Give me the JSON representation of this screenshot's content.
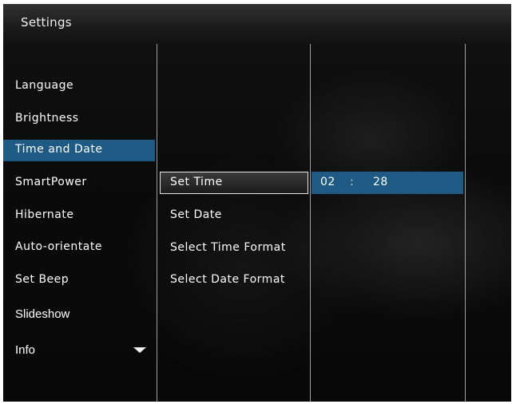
{
  "title_bar": {
    "title": "Settings"
  },
  "level1_menu": {
    "items": [
      {
        "label": "Language"
      },
      {
        "label": "Brightness"
      },
      {
        "label": "Time and Date"
      },
      {
        "label": "SmartPower"
      },
      {
        "label": "Hibernate"
      },
      {
        "label": "Auto-orientate"
      },
      {
        "label": "Set Beep"
      },
      {
        "label": "Slideshow"
      },
      {
        "label": "Info"
      }
    ],
    "selected_index": 2,
    "scroll_icon": "chevron-down-icon"
  },
  "level2_menu": {
    "items": [
      {
        "label": "Set Time"
      },
      {
        "label": "Set Date"
      },
      {
        "label": "Select Time Format"
      },
      {
        "label": "Select Date Format"
      }
    ],
    "selected_index": 0
  },
  "time_editor": {
    "hour": "02",
    "separator": ":",
    "minute": "28"
  },
  "colors": {
    "highlight_blue": "#1d5a84",
    "text": "#ffffff",
    "background": "#0b0b0b"
  }
}
